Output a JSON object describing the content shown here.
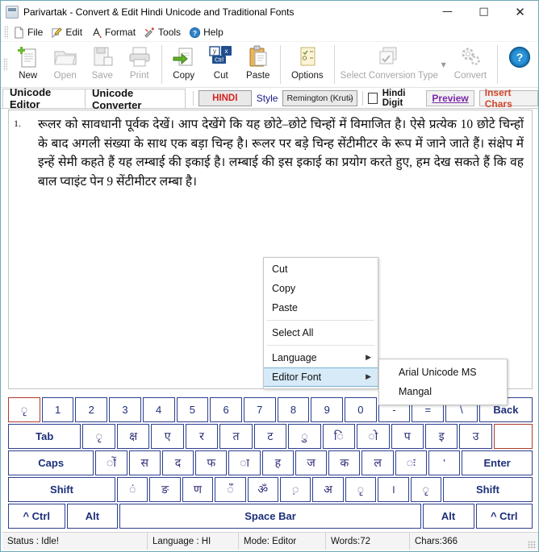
{
  "window": {
    "title": "Parivartak - Convert & Edit Hindi Unicode and Traditional Fonts",
    "app_icon": "app-icon",
    "minimize": "—",
    "maximize": "□",
    "close": "✕"
  },
  "menubar": {
    "items": [
      {
        "label": "File",
        "icon": "file-icon"
      },
      {
        "label": "Edit",
        "icon": "pencil-icon"
      },
      {
        "label": "Format",
        "icon": "format-icon"
      },
      {
        "label": "Tools",
        "icon": "tools-icon"
      },
      {
        "label": "Help",
        "icon": "help-icon"
      }
    ]
  },
  "toolbar": {
    "buttons": [
      {
        "label": "New",
        "icon": "new-document-icon",
        "enabled": true
      },
      {
        "label": "Open",
        "icon": "open-folder-icon",
        "enabled": false
      },
      {
        "label": "Save",
        "icon": "save-icon",
        "enabled": false
      },
      {
        "label": "Print",
        "icon": "printer-icon",
        "enabled": false
      },
      {
        "label": "Copy",
        "icon": "copy-icon",
        "enabled": true
      },
      {
        "label": "Cut",
        "icon": "cut-icon",
        "enabled": true
      },
      {
        "label": "Paste",
        "icon": "paste-icon",
        "enabled": true
      },
      {
        "label": "Options",
        "icon": "options-icon",
        "enabled": true
      },
      {
        "label": "Select Conversion Type",
        "icon": "conversion-type-icon",
        "enabled": false
      },
      {
        "label": "Convert",
        "icon": "gears-icon",
        "enabled": false
      },
      {
        "label": "",
        "icon": "help-round-icon",
        "enabled": true
      }
    ],
    "dropdown_caret": "▼"
  },
  "tabs": [
    {
      "label": "Unicode Editor",
      "active": true
    },
    {
      "label": "Unicode Converter",
      "active": false
    }
  ],
  "tabtools": {
    "hindi_button": "HINDI",
    "style_label": "Style",
    "style_value": "Remington (Kruti)",
    "style_arrow": "⌄",
    "hindi_digit_label": "Hindi Digit",
    "hindi_digit_checked": false,
    "preview_button": "Preview",
    "insert_chars_button": "Insert Chars"
  },
  "editor": {
    "list_number": "1.",
    "text": "रूलर को सावधानी पूर्वक देखें। आप देखेंगे कि यह छोटे–छोटे चिन्हों में विमाजित है। ऐसे प्रत्येक 10 छोटे चिन्हों के बाद अगली संख्या के साथ एक बड़ा चिन्ह है। रूलर पर बड़े चिन्ह सेंटीमीटर के रूप में जाने जाते हैं। संक्षेप में इन्हें सेमी कहते हैं यह लम्बाई की इकाई है। लम्बाई की इस इकाई का प्रयोग करते हुए, हम देख सकते हैं कि वह बाल प्वाइंट पेन 9 सेंटीमीटर लम्बा है।"
  },
  "context_menu": {
    "items": [
      {
        "label": "Cut",
        "submenu": false,
        "highlight": false
      },
      {
        "label": "Copy",
        "submenu": false,
        "highlight": false
      },
      {
        "label": "Paste",
        "submenu": false,
        "highlight": false
      },
      {
        "label": "Select All",
        "submenu": false,
        "highlight": false
      },
      {
        "label": "Language",
        "submenu": true,
        "highlight": false
      },
      {
        "label": "Editor Font",
        "submenu": true,
        "highlight": true
      }
    ],
    "submenu_arrow": "▶",
    "submenu": {
      "items": [
        {
          "label": "Arial Unicode MS"
        },
        {
          "label": "Mangal"
        }
      ]
    }
  },
  "keyboard": {
    "rows": [
      {
        "keys": [
          {
            "label": "ृ",
            "w": 1,
            "type": "dev",
            "red": true
          },
          {
            "label": "1",
            "w": 1,
            "type": "num"
          },
          {
            "label": "2",
            "w": 1,
            "type": "num"
          },
          {
            "label": "3",
            "w": 1,
            "type": "num"
          },
          {
            "label": "4",
            "w": 1,
            "type": "num"
          },
          {
            "label": "5",
            "w": 1,
            "type": "num"
          },
          {
            "label": "6",
            "w": 1,
            "type": "num"
          },
          {
            "label": "7",
            "w": 1,
            "type": "num"
          },
          {
            "label": "8",
            "w": 1,
            "type": "num"
          },
          {
            "label": "9",
            "w": 1,
            "type": "num"
          },
          {
            "label": "0",
            "w": 1,
            "type": "num"
          },
          {
            "label": "-",
            "w": 1,
            "type": "sym"
          },
          {
            "label": "=",
            "w": 1,
            "type": "sym"
          },
          {
            "label": "\\",
            "w": 1,
            "type": "sym"
          },
          {
            "label": "Back",
            "w": 1.7,
            "type": "mod"
          }
        ]
      },
      {
        "keys": [
          {
            "label": "Tab",
            "w": 2.3,
            "type": "mod"
          },
          {
            "label": "ृ",
            "w": 1,
            "type": "dev"
          },
          {
            "label": "क्ष",
            "w": 1,
            "type": "dev"
          },
          {
            "label": "ए",
            "w": 1,
            "type": "dev"
          },
          {
            "label": "र",
            "w": 1,
            "type": "dev"
          },
          {
            "label": "त",
            "w": 1,
            "type": "dev"
          },
          {
            "label": "ट",
            "w": 1,
            "type": "dev"
          },
          {
            "label": "ु",
            "w": 1,
            "type": "dev"
          },
          {
            "label": "िं",
            "w": 1,
            "type": "dev"
          },
          {
            "label": "ो",
            "w": 1,
            "type": "dev"
          },
          {
            "label": "प",
            "w": 1,
            "type": "dev"
          },
          {
            "label": "इ",
            "w": 1,
            "type": "dev"
          },
          {
            "label": "उ",
            "w": 1,
            "type": "dev"
          },
          {
            "label": "",
            "w": 1.2,
            "type": "empty",
            "red": true
          }
        ]
      },
      {
        "keys": [
          {
            "label": "Caps",
            "w": 2.8,
            "type": "mod"
          },
          {
            "label": "ों",
            "w": 1,
            "type": "dev"
          },
          {
            "label": "स",
            "w": 1,
            "type": "dev"
          },
          {
            "label": "द",
            "w": 1,
            "type": "dev"
          },
          {
            "label": "फ",
            "w": 1,
            "type": "dev"
          },
          {
            "label": "ा",
            "w": 1,
            "type": "dev"
          },
          {
            "label": "ह",
            "w": 1,
            "type": "dev"
          },
          {
            "label": "ज",
            "w": 1,
            "type": "dev"
          },
          {
            "label": "क",
            "w": 1,
            "type": "dev"
          },
          {
            "label": "ल",
            "w": 1,
            "type": "dev"
          },
          {
            "label": "ः",
            "w": 1,
            "type": "dev"
          },
          {
            "label": "'",
            "w": 1,
            "type": "sym"
          },
          {
            "label": "Enter",
            "w": 2.3,
            "type": "mod"
          }
        ]
      },
      {
        "keys": [
          {
            "label": "Shift",
            "w": 3.6,
            "type": "mod"
          },
          {
            "label": "ं",
            "w": 1,
            "type": "dev"
          },
          {
            "label": "ङ",
            "w": 1,
            "type": "dev"
          },
          {
            "label": "ण",
            "w": 1,
            "type": "dev"
          },
          {
            "label": "ँ",
            "w": 1,
            "type": "dev"
          },
          {
            "label": "ॐ",
            "w": 1,
            "type": "dev"
          },
          {
            "label": "़",
            "w": 1,
            "type": "dev"
          },
          {
            "label": "अ",
            "w": 1,
            "type": "dev"
          },
          {
            "label": "ृ",
            "w": 1,
            "type": "dev"
          },
          {
            "label": "।",
            "w": 1,
            "type": "dev"
          },
          {
            "label": "ृ",
            "w": 1,
            "type": "dev"
          },
          {
            "label": "Shift",
            "w": 3.0,
            "type": "mod"
          }
        ]
      },
      {
        "keys": [
          {
            "label": "^ Ctrl",
            "w": 1.55,
            "type": "mod"
          },
          {
            "label": "Alt",
            "w": 1.4,
            "type": "mod"
          },
          {
            "label": "Space Bar",
            "w": 8.4,
            "type": "space"
          },
          {
            "label": "Alt",
            "w": 1.4,
            "type": "mod"
          },
          {
            "label": "^ Ctrl",
            "w": 1.55,
            "type": "mod"
          }
        ]
      }
    ]
  },
  "statusbar": {
    "status": "Status : Idle!",
    "language": "Language : HI",
    "mode": "Mode: Editor",
    "words": "Words:72",
    "chars": "Chars:366"
  }
}
